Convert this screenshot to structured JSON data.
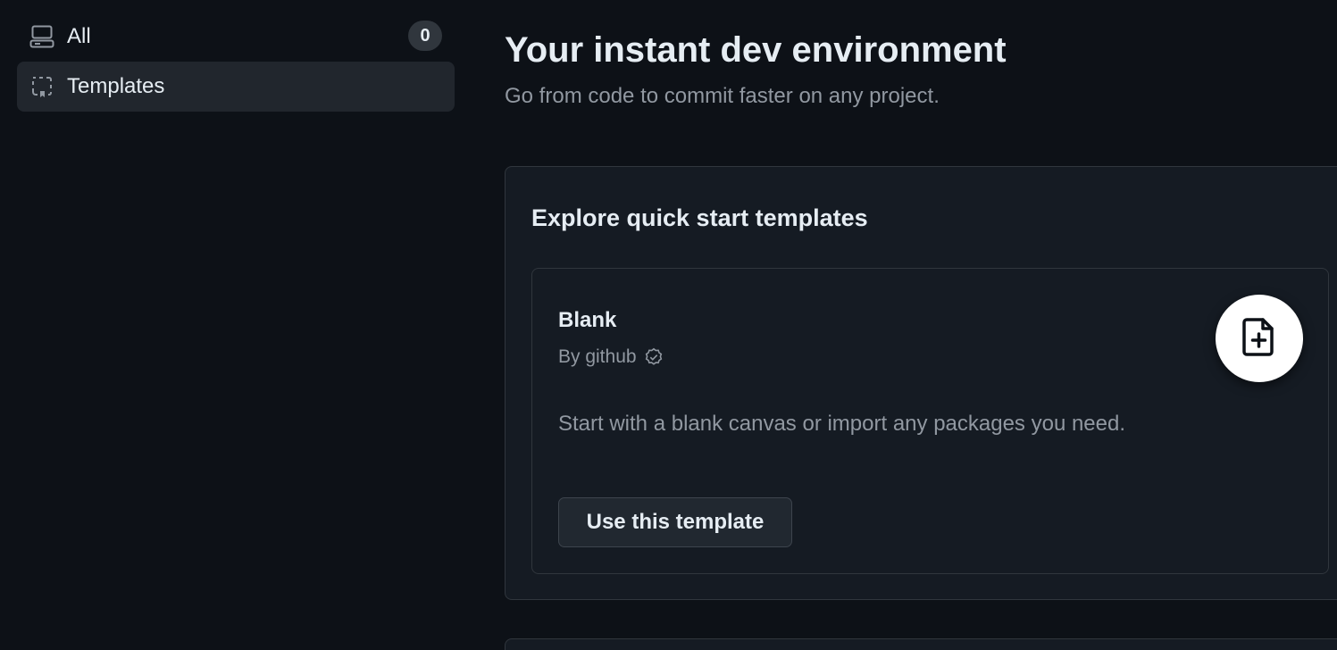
{
  "sidebar": {
    "items": [
      {
        "label": "All",
        "count": "0",
        "icon": "codespaces-icon",
        "active": false
      },
      {
        "label": "Templates",
        "icon": "repo-template-icon",
        "active": true
      }
    ]
  },
  "main": {
    "title": "Your instant dev environment",
    "subtitle": "Go from code to commit faster on any project.",
    "templates_section": {
      "title": "Explore quick start templates",
      "cards": [
        {
          "name": "Blank",
          "author": "By github",
          "author_icon": "verified-icon",
          "description": "Start with a blank canvas or import any packages you need.",
          "button_label": "Use this template",
          "icon": "file-plus-icon"
        }
      ]
    }
  },
  "colors": {
    "background": "#0d1117",
    "panel": "#151b23",
    "border": "#30363d",
    "text_primary": "#e6edf3",
    "text_muted": "#9198a1",
    "active_nav": "#21262d"
  }
}
